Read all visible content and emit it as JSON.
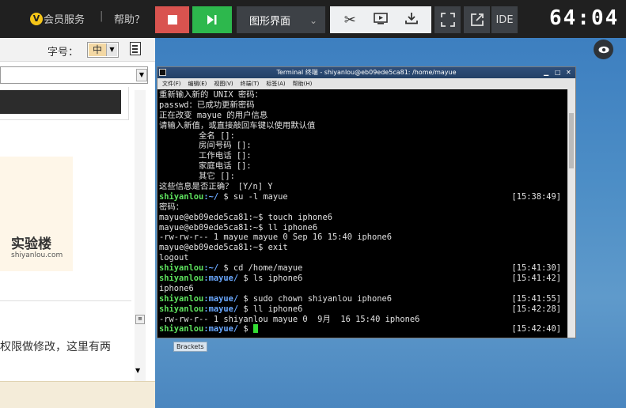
{
  "topbar": {
    "vip_badge": "V",
    "vip_label": "会员服务",
    "separator": "|",
    "help_label": "帮助？",
    "mode_label": "图形界面",
    "ide_label": "IDE",
    "timer": "64:04"
  },
  "left_panel": {
    "font_size_label": "字号：",
    "font_size_value": "中",
    "logo_text": "实验楼",
    "logo_sub": "shiyanlou.com",
    "body_text": "权限做修改，这里有两"
  },
  "desktop": {
    "icon_label": "Brackets"
  },
  "terminal": {
    "title": "Terminal 终端 - shiyanlou@eb09ede5ca81: /home/mayue",
    "win_controls": [
      "▁",
      "□",
      "✕"
    ],
    "menu": [
      "文件(F)",
      "编辑(E)",
      "视图(V)",
      "终端(T)",
      "标签(A)",
      "帮助(H)"
    ],
    "lines": [
      {
        "text": "重新输入新的 UNIX 密码："
      },
      {
        "text": "passwd：已成功更新密码"
      },
      {
        "text": "正在改变 mayue 的用户信息"
      },
      {
        "text": "请输入新值，或直接敲回车键以使用默认值"
      },
      {
        "text": "\t全名 []:"
      },
      {
        "text": "\t房间号码 []:"
      },
      {
        "text": "\t工作电话 []:"
      },
      {
        "text": "\t家庭电话 []:"
      },
      {
        "text": "\t其它 []:"
      },
      {
        "text": "这些信息是否正确？ [Y/n] Y"
      },
      {
        "user": "shiyanlou",
        "path": ":~/",
        "cmd": " $ su -l mayue",
        "ts": "[15:38:49]"
      },
      {
        "text": "密码："
      },
      {
        "text": "mayue@eb09ede5ca81:~$ touch iphone6"
      },
      {
        "text": "mayue@eb09ede5ca81:~$ ll iphone6"
      },
      {
        "text": "-rw-rw-r-- 1 mayue mayue 0 Sep 16 15:40 iphone6"
      },
      {
        "text": "mayue@eb09ede5ca81:~$ exit"
      },
      {
        "text": "logout"
      },
      {
        "user": "shiyanlou",
        "path": ":~/",
        "cmd": " $ cd /home/mayue",
        "ts": "[15:41:30]"
      },
      {
        "user": "shiyanlou",
        "path": ":mayue/",
        "cmd": " $ ls iphone6",
        "ts": "[15:41:42]"
      },
      {
        "text": "iphone6"
      },
      {
        "user": "shiyanlou",
        "path": ":mayue/",
        "cmd": " $ sudo chown shiyanlou iphone6",
        "ts": "[15:41:55]"
      },
      {
        "user": "shiyanlou",
        "path": ":mayue/",
        "cmd": " $ ll iphone6",
        "ts": "[15:42:28]"
      },
      {
        "text": "-rw-rw-r-- 1 shiyanlou mayue 0  9月  16 15:40 iphone6"
      },
      {
        "user": "shiyanlou",
        "path": ":mayue/",
        "cmd": " $ ",
        "ts": "[15:42:40]",
        "cursor": true
      }
    ]
  },
  "colors": {
    "stop": "#d9534f",
    "play": "#2db84d",
    "prompt_user": "#5ee15e",
    "prompt_path": "#6aa8ff"
  }
}
